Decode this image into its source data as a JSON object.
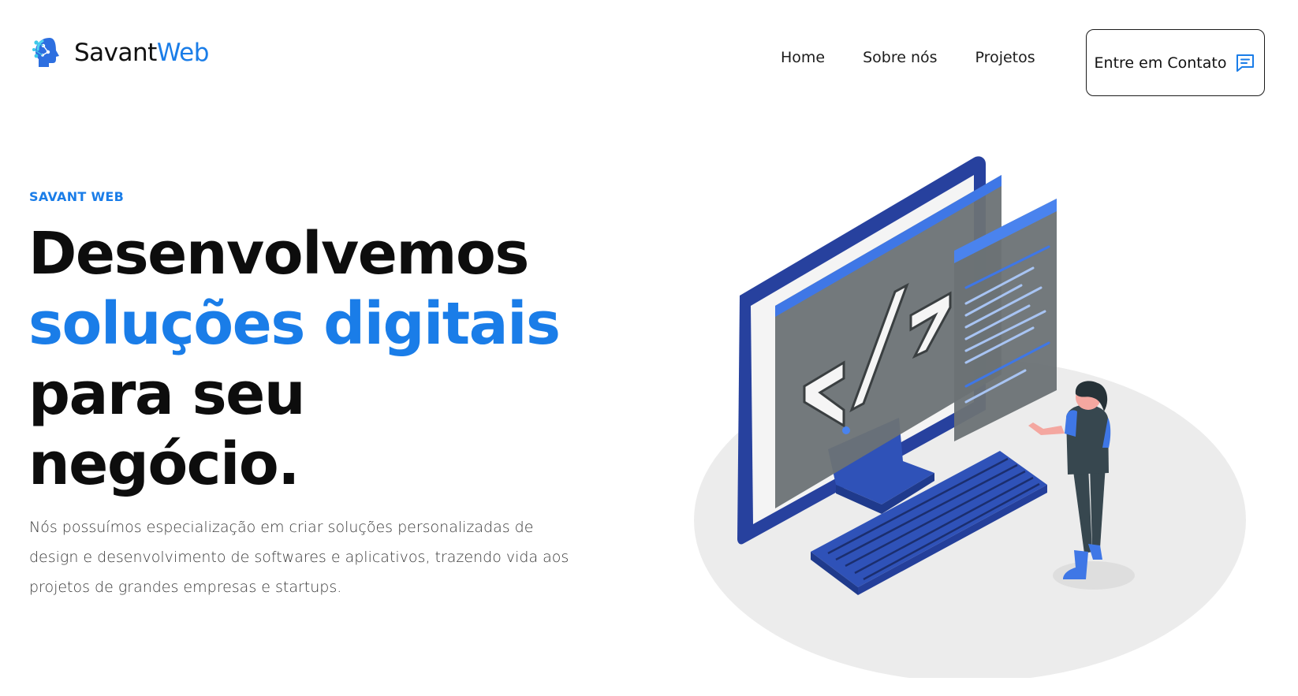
{
  "header": {
    "logo": {
      "name_part1": "Savant",
      "name_part2": "Web"
    },
    "nav": [
      {
        "label": "Home"
      },
      {
        "label": "Sobre nós"
      },
      {
        "label": "Projetos"
      }
    ],
    "cta": {
      "label": "Entre em Contato",
      "icon": "chat-icon"
    }
  },
  "hero": {
    "eyebrow": "SAVANT WEB",
    "headline": {
      "line1": "Desenvolvemos",
      "line2": "soluções digitais",
      "line3": "para seu",
      "line4": "negócio."
    },
    "description": "Nós possuímos especialização em criar soluções personalizadas de design e desenvolvimento de softwares e aplicativos, trazendo vida aos projetos de grandes empresas e startups.",
    "illustration": {
      "icon": "developer-computer-illustration"
    }
  },
  "colors": {
    "accent": "#1a7de8",
    "text": "#111111",
    "monitor_blue": "#27419e",
    "screen_gray": "#6b7275"
  }
}
